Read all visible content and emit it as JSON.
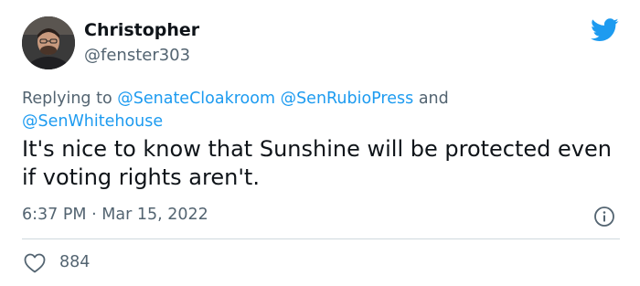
{
  "author": {
    "display_name": "Christopher",
    "handle": "@fenster303"
  },
  "reply": {
    "prefix": "Replying to",
    "mention_1": "@SenateCloakroom",
    "mention_2": "@SenRubioPress",
    "conjunction": "and",
    "mention_3": "@SenWhitehouse"
  },
  "tweet": {
    "text": "It's nice to know that Sunshine will be protected even if voting rights aren't.",
    "time": "6:37 PM",
    "separator": "·",
    "date": "Mar 15, 2022"
  },
  "engagement": {
    "likes": "884"
  },
  "icons": {
    "logo": "twitter-bird-icon",
    "info": "info-icon",
    "like": "heart-icon"
  },
  "colors": {
    "brand": "#1d9bf0",
    "text": "#0f1419",
    "secondary": "#536471",
    "divider": "#cfd9de"
  }
}
